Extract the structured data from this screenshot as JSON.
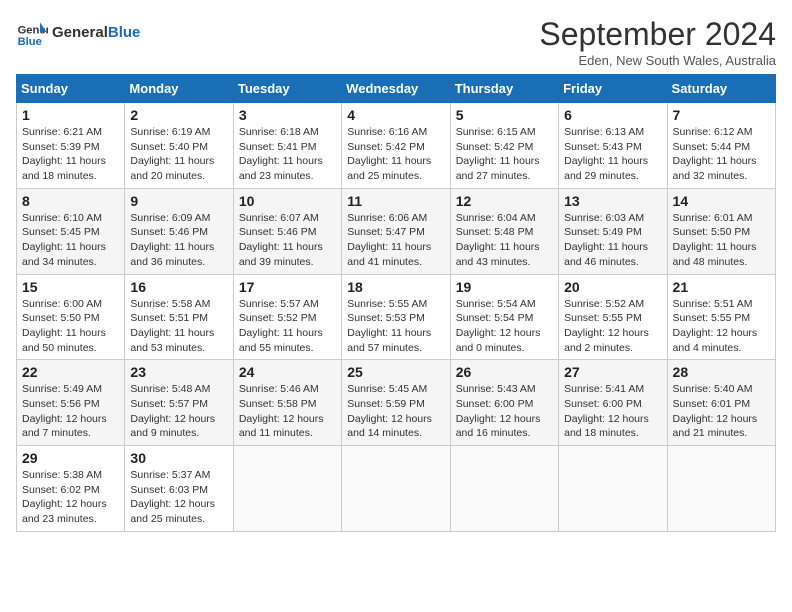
{
  "header": {
    "logo_line1": "General",
    "logo_line2": "Blue",
    "month": "September 2024",
    "location": "Eden, New South Wales, Australia"
  },
  "weekdays": [
    "Sunday",
    "Monday",
    "Tuesday",
    "Wednesday",
    "Thursday",
    "Friday",
    "Saturday"
  ],
  "weeks": [
    [
      {
        "day": "1",
        "sunrise": "6:21 AM",
        "sunset": "5:39 PM",
        "daylight": "11 hours and 18 minutes."
      },
      {
        "day": "2",
        "sunrise": "6:19 AM",
        "sunset": "5:40 PM",
        "daylight": "11 hours and 20 minutes."
      },
      {
        "day": "3",
        "sunrise": "6:18 AM",
        "sunset": "5:41 PM",
        "daylight": "11 hours and 23 minutes."
      },
      {
        "day": "4",
        "sunrise": "6:16 AM",
        "sunset": "5:42 PM",
        "daylight": "11 hours and 25 minutes."
      },
      {
        "day": "5",
        "sunrise": "6:15 AM",
        "sunset": "5:42 PM",
        "daylight": "11 hours and 27 minutes."
      },
      {
        "day": "6",
        "sunrise": "6:13 AM",
        "sunset": "5:43 PM",
        "daylight": "11 hours and 29 minutes."
      },
      {
        "day": "7",
        "sunrise": "6:12 AM",
        "sunset": "5:44 PM",
        "daylight": "11 hours and 32 minutes."
      }
    ],
    [
      {
        "day": "8",
        "sunrise": "6:10 AM",
        "sunset": "5:45 PM",
        "daylight": "11 hours and 34 minutes."
      },
      {
        "day": "9",
        "sunrise": "6:09 AM",
        "sunset": "5:46 PM",
        "daylight": "11 hours and 36 minutes."
      },
      {
        "day": "10",
        "sunrise": "6:07 AM",
        "sunset": "5:46 PM",
        "daylight": "11 hours and 39 minutes."
      },
      {
        "day": "11",
        "sunrise": "6:06 AM",
        "sunset": "5:47 PM",
        "daylight": "11 hours and 41 minutes."
      },
      {
        "day": "12",
        "sunrise": "6:04 AM",
        "sunset": "5:48 PM",
        "daylight": "11 hours and 43 minutes."
      },
      {
        "day": "13",
        "sunrise": "6:03 AM",
        "sunset": "5:49 PM",
        "daylight": "11 hours and 46 minutes."
      },
      {
        "day": "14",
        "sunrise": "6:01 AM",
        "sunset": "5:50 PM",
        "daylight": "11 hours and 48 minutes."
      }
    ],
    [
      {
        "day": "15",
        "sunrise": "6:00 AM",
        "sunset": "5:50 PM",
        "daylight": "11 hours and 50 minutes."
      },
      {
        "day": "16",
        "sunrise": "5:58 AM",
        "sunset": "5:51 PM",
        "daylight": "11 hours and 53 minutes."
      },
      {
        "day": "17",
        "sunrise": "5:57 AM",
        "sunset": "5:52 PM",
        "daylight": "11 hours and 55 minutes."
      },
      {
        "day": "18",
        "sunrise": "5:55 AM",
        "sunset": "5:53 PM",
        "daylight": "11 hours and 57 minutes."
      },
      {
        "day": "19",
        "sunrise": "5:54 AM",
        "sunset": "5:54 PM",
        "daylight": "12 hours and 0 minutes."
      },
      {
        "day": "20",
        "sunrise": "5:52 AM",
        "sunset": "5:55 PM",
        "daylight": "12 hours and 2 minutes."
      },
      {
        "day": "21",
        "sunrise": "5:51 AM",
        "sunset": "5:55 PM",
        "daylight": "12 hours and 4 minutes."
      }
    ],
    [
      {
        "day": "22",
        "sunrise": "5:49 AM",
        "sunset": "5:56 PM",
        "daylight": "12 hours and 7 minutes."
      },
      {
        "day": "23",
        "sunrise": "5:48 AM",
        "sunset": "5:57 PM",
        "daylight": "12 hours and 9 minutes."
      },
      {
        "day": "24",
        "sunrise": "5:46 AM",
        "sunset": "5:58 PM",
        "daylight": "12 hours and 11 minutes."
      },
      {
        "day": "25",
        "sunrise": "5:45 AM",
        "sunset": "5:59 PM",
        "daylight": "12 hours and 14 minutes."
      },
      {
        "day": "26",
        "sunrise": "5:43 AM",
        "sunset": "6:00 PM",
        "daylight": "12 hours and 16 minutes."
      },
      {
        "day": "27",
        "sunrise": "5:41 AM",
        "sunset": "6:00 PM",
        "daylight": "12 hours and 18 minutes."
      },
      {
        "day": "28",
        "sunrise": "5:40 AM",
        "sunset": "6:01 PM",
        "daylight": "12 hours and 21 minutes."
      }
    ],
    [
      {
        "day": "29",
        "sunrise": "5:38 AM",
        "sunset": "6:02 PM",
        "daylight": "12 hours and 23 minutes."
      },
      {
        "day": "30",
        "sunrise": "5:37 AM",
        "sunset": "6:03 PM",
        "daylight": "12 hours and 25 minutes."
      },
      null,
      null,
      null,
      null,
      null
    ]
  ],
  "labels": {
    "sunrise": "Sunrise:",
    "sunset": "Sunset:",
    "daylight": "Daylight:"
  }
}
